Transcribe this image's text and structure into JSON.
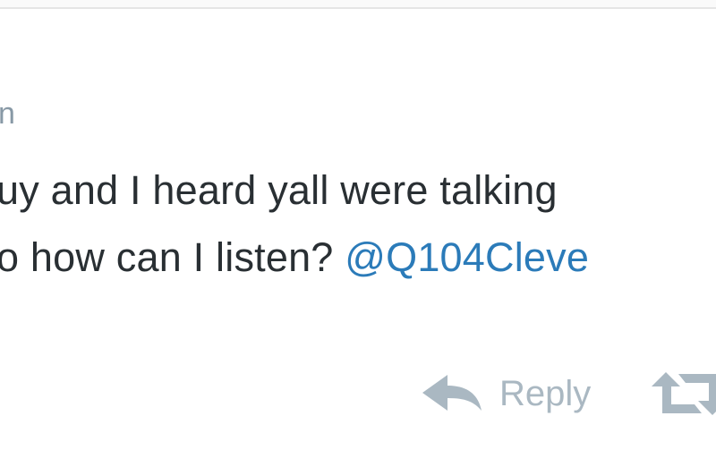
{
  "tweet": {
    "handle_fragment": "n",
    "line1_text": "uy and I heard yall were talking",
    "line2_text": "o how can I listen? ",
    "mention": "@Q104Cleve"
  },
  "actions": {
    "reply_label": "Reply",
    "reply_icon": "reply-arrow-icon",
    "retweet_icon": "retweet-icon"
  },
  "colors": {
    "text": "#292f33",
    "muted": "#8899a6",
    "link": "#2b7bb9",
    "action": "#aab8c2"
  }
}
